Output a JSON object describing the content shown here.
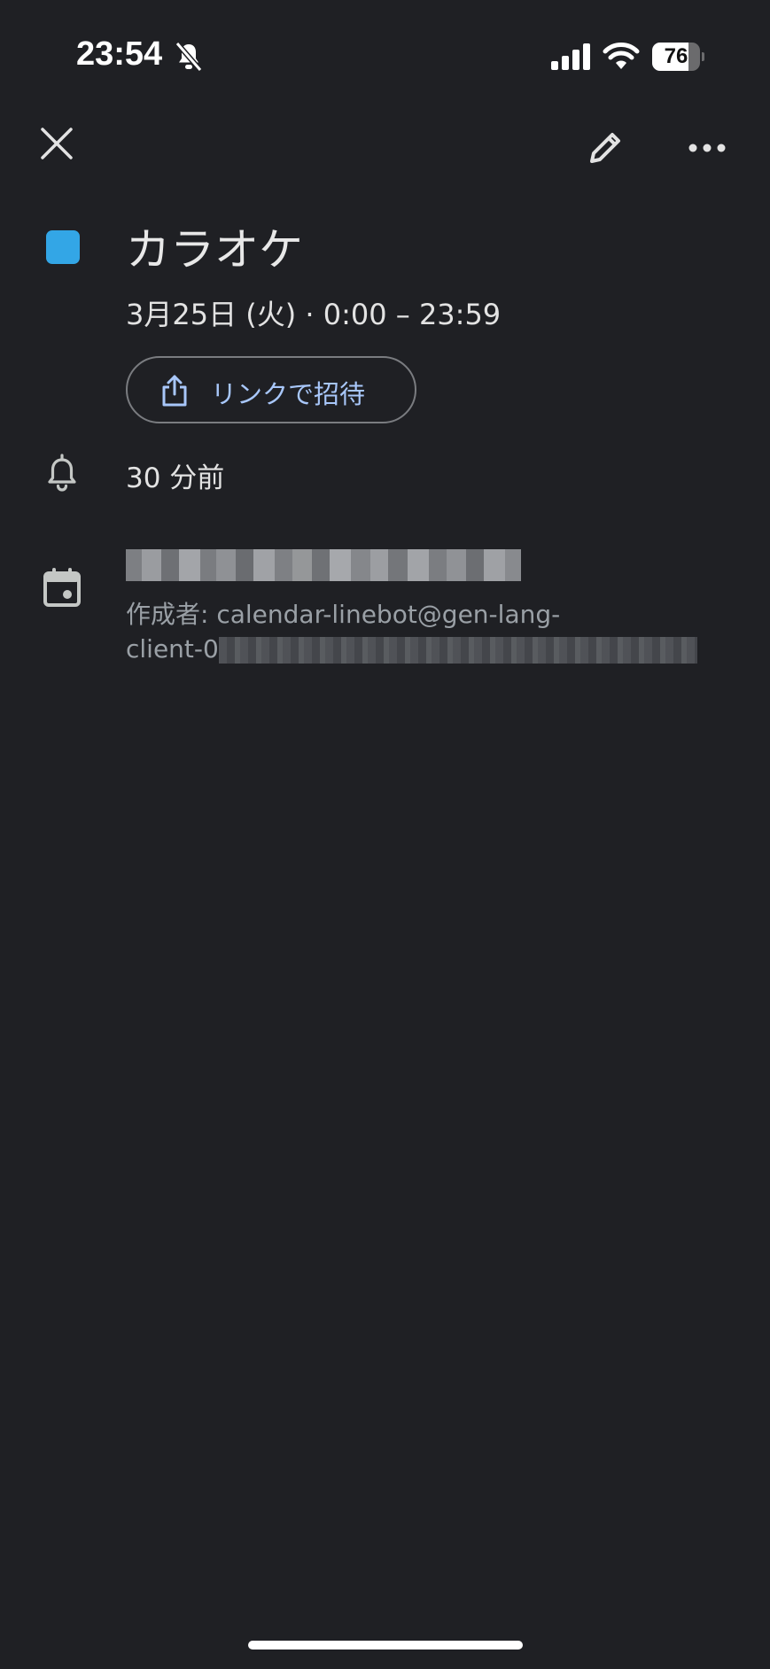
{
  "status_bar": {
    "time": "23:54",
    "battery_level": "76",
    "battery_fraction": 0.76
  },
  "toolbar": {
    "close_icon": "close-icon",
    "edit_icon": "pencil-icon",
    "more_icon": "more-horizontal-icon"
  },
  "event": {
    "color": "#33a6e6",
    "title": "カラオケ",
    "date_time": "3月25日 (火) · 0:00 – 23:59",
    "invite_button_label": "リンクで招待",
    "reminder": "30 分前",
    "calendar_email": "[redacted]@gmail.com",
    "creator_line1": "作成者: calendar-linebot@gen-lang-",
    "creator_line2_prefix": "client-0"
  },
  "colors": {
    "background": "#1f2024",
    "accent_link": "#a8c7fa"
  }
}
